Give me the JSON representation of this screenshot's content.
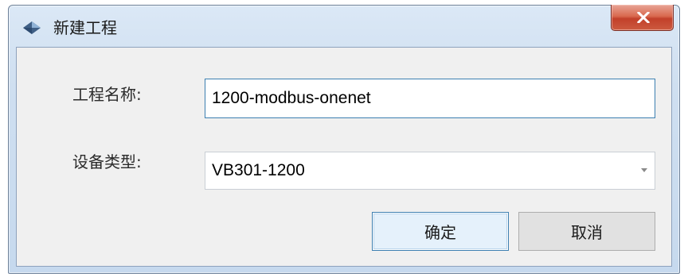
{
  "window": {
    "title": "新建工程",
    "close_glyph": "X"
  },
  "form": {
    "name_label": "工程名称:",
    "name_value": "1200-modbus-onenet",
    "type_label": "设备类型:",
    "type_value": "VB301-1200"
  },
  "buttons": {
    "ok_label": "确定",
    "cancel_label": "取消"
  },
  "icons": {
    "app": "diamond-app-icon",
    "close": "close-icon",
    "dropdown": "chevron-down-icon"
  },
  "colors": {
    "close_button": "#d9694f",
    "focus_border": "#3c7fb1",
    "titlebar": "#dbe8f6",
    "client_bg": "#f0f0f0"
  }
}
